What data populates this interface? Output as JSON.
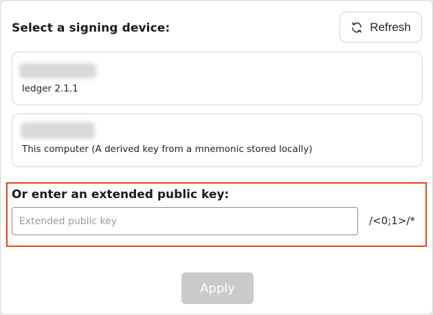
{
  "header": {
    "title": "Select a signing device:",
    "refresh_label": "Refresh",
    "refresh_icon": "refresh-icon"
  },
  "devices": [
    {
      "name_redacted": true,
      "label": "ledger  2.1.1"
    },
    {
      "name_redacted": true,
      "label": "This computer (A derived key from a mnemonic stored locally)"
    }
  ],
  "xpub": {
    "title": "Or enter an extended public key:",
    "placeholder": "Extended public key",
    "value": "",
    "suffix": "/<0;1>/*"
  },
  "apply_label": "Apply",
  "colors": {
    "highlight": "#e8441b",
    "apply_disabled_bg": "#cacaca"
  }
}
